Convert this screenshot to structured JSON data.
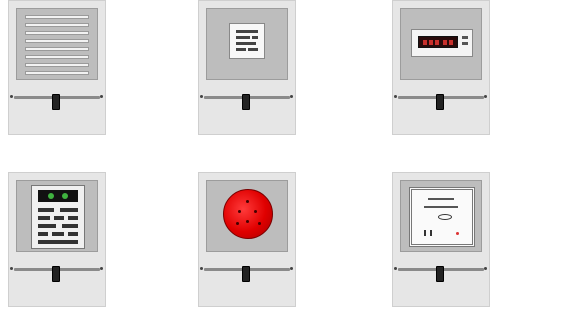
{
  "cards": [
    {
      "caption": "",
      "value": "",
      "description": "",
      "icon": "window-blinds-icon"
    },
    {
      "caption": "",
      "value": "",
      "description": "",
      "icon": "control-panel-icon"
    },
    {
      "caption": "",
      "value": "",
      "description": "",
      "icon": "digital-display-icon"
    },
    {
      "caption": "",
      "value": "",
      "description": "",
      "icon": "keypad-device-icon"
    },
    {
      "caption": "",
      "value": "",
      "description": "",
      "icon": "red-emergency-button-icon"
    },
    {
      "caption": "",
      "value": "",
      "description": "",
      "icon": "document-frame-icon"
    }
  ],
  "colors": {
    "card_bg": "#e6e6e6",
    "thumb_bg": "#bdbdbd",
    "slider_knob": "#222222",
    "display_red": "#c9302c",
    "led_green": "#3fb23f",
    "emergency_red": "#e00000"
  }
}
